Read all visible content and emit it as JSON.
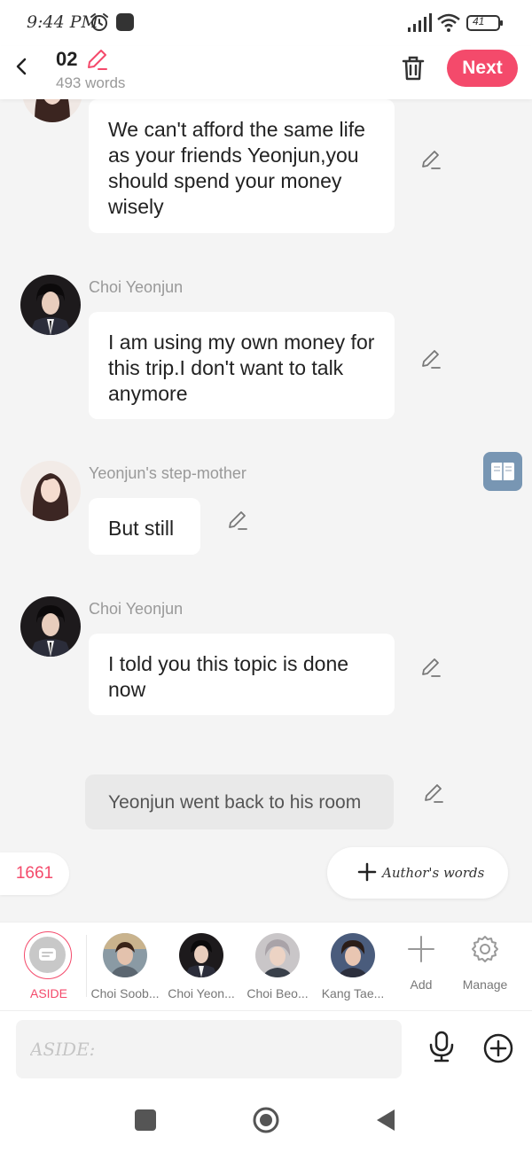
{
  "status_bar": {
    "time": "9:44 PM",
    "battery": "41"
  },
  "header": {
    "title": "02",
    "word_count": "493 words",
    "next_label": "Next"
  },
  "messages": [
    {
      "speaker": "",
      "text": "We can't afford the same life as your friends Yeonjun,you should spend your money wisely"
    },
    {
      "speaker": "Choi Yeonjun",
      "text": "I am using my own money for this trip.I don't want to talk anymore"
    },
    {
      "speaker": "Yeonjun's step-mother",
      "text": "But still"
    },
    {
      "speaker": "Choi Yeonjun",
      "text": "I told you this topic is done now"
    }
  ],
  "aside_message": "Yeonjun went back to his room",
  "count_chip": "1661",
  "author_words_label": "Author's words",
  "characters": [
    {
      "name": "ASIDE",
      "active": true
    },
    {
      "name": "Choi Soob..."
    },
    {
      "name": "Choi Yeon..."
    },
    {
      "name": "Choi Beo..."
    },
    {
      "name": "Kang Tae..."
    }
  ],
  "add_label": "Add",
  "manage_label": "Manage",
  "input": {
    "placeholder": "ASIDE:",
    "value": ""
  },
  "colors": {
    "accent": "#f44a6b",
    "background": "#f4f4f4",
    "bubble": "#ffffff",
    "aside_bubble": "#e9e9e9",
    "reader_icon": "#7896b3"
  }
}
